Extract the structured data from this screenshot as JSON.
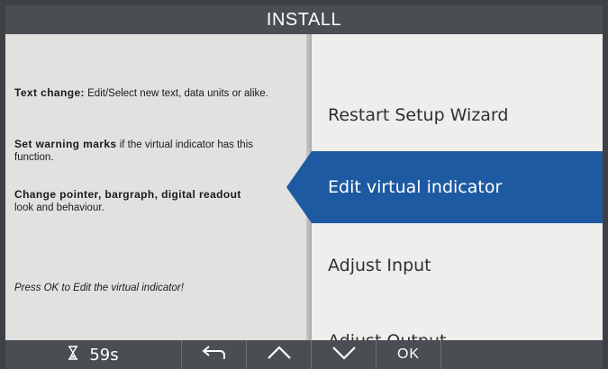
{
  "header": {
    "title": "INSTALL"
  },
  "help": {
    "para1_bold": "Text change:",
    "para1_text": " Edit/Select new text, data units or alike.",
    "para2_bold": "Set warning marks",
    "para2_text": " if the virtual indicator has this function.",
    "para3_bold": "Change pointer, bargraph, digital readout",
    "para3_text": " look and behaviour.",
    "hint": "Press OK to Edit the virtual indicator!"
  },
  "menu": {
    "items": [
      {
        "label": "Restart Setup Wizard"
      },
      {
        "label": "Edit virtual indicator",
        "selected": true
      },
      {
        "label": "Adjust Input"
      },
      {
        "label": "Adjust Output"
      }
    ]
  },
  "footer": {
    "timer": "59s",
    "ok_label": "OK"
  },
  "colors": {
    "accent": "#1e5aa2",
    "bar": "#4a4d52",
    "panel_left": "#e1e1df",
    "panel_right": "#eeeeec"
  },
  "icons": [
    "hourglass-icon",
    "back-arrow-icon",
    "chevron-up-icon",
    "chevron-down-icon"
  ]
}
